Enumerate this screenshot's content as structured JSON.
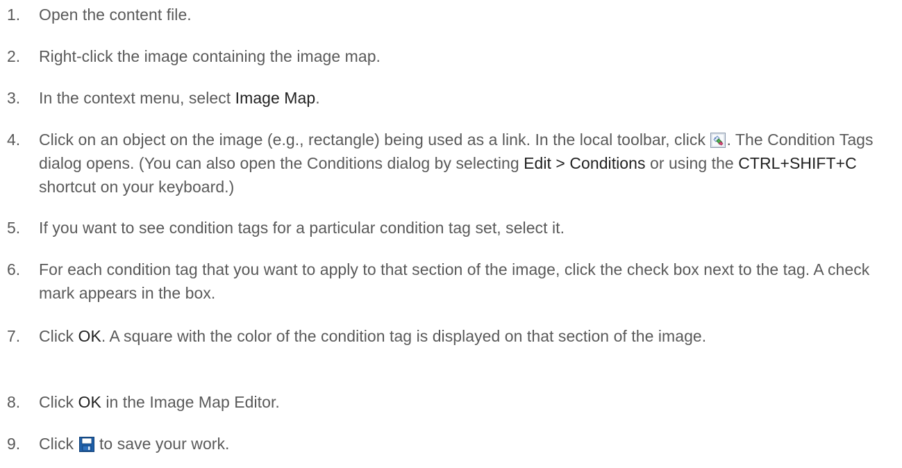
{
  "steps": [
    {
      "num": "1.",
      "text": "Open the content file."
    },
    {
      "num": "2.",
      "text": "Right-click the image containing the image map."
    },
    {
      "num": "3.",
      "pre": "In the context menu, select ",
      "strong": "Image Map",
      "post": "."
    },
    {
      "num": "4.",
      "pre": "Click on an object on the image (e.g., rectangle) being used as a link. In the local toolbar, click ",
      "icon": "condition-tags-icon",
      "mid": ". The Condition Tags dialog opens. (You can also open the Conditions dialog by selecting ",
      "strong1": "Edit > Conditions",
      "mid2": " or using the ",
      "strong2": "CTRL+SHIFT+C",
      "post": " shortcut on your keyboard.)"
    },
    {
      "num": "5.",
      "text": "If you want to see condition tags for a particular condition tag set, select it."
    },
    {
      "num": "6.",
      "text": "For each condition tag that you want to apply to that section of the image, click the check box next to the tag. A check mark appears in the box."
    },
    {
      "num": "7.",
      "pre": "Click ",
      "strong": "OK",
      "post": ". A square with the color of the condition tag is displayed on that section of the image."
    },
    {
      "num": "8.",
      "pre": "Click ",
      "strong": "OK",
      "post": " in the Image Map Editor."
    },
    {
      "num": "9.",
      "pre": "Click ",
      "icon": "save-icon",
      "post": " to save your work."
    }
  ],
  "colors": {
    "body_text": "#595959",
    "emphasis_text": "#1f1f1f",
    "save_icon": "#1f5fa8"
  }
}
